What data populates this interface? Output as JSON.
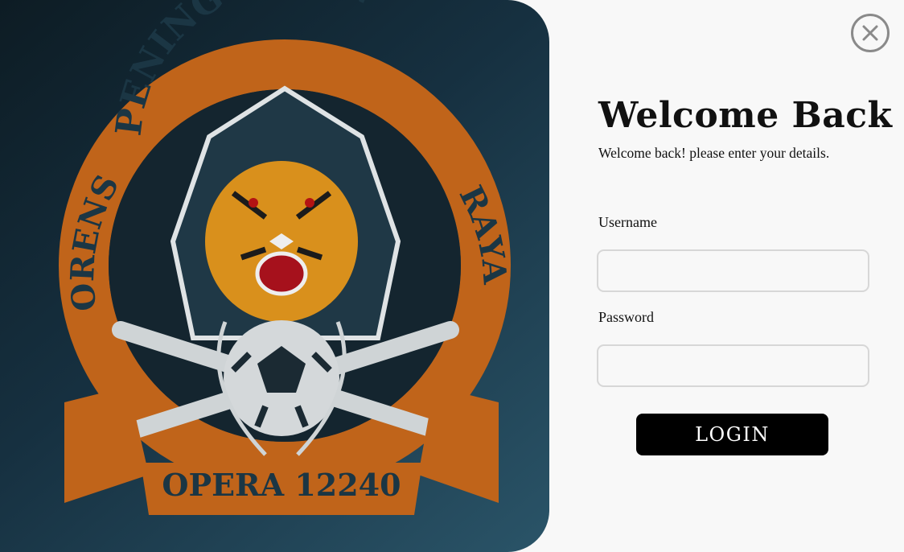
{
  "logo": {
    "name": "orens-peninggaran-raya-crest",
    "text_top": "PENINGGARAN",
    "text_left": "ORENS",
    "text_right": "RAYA",
    "text_banner": "OPERA 12240"
  },
  "colors": {
    "panel_dark": "#0d1c24",
    "panel_light": "#2a5468",
    "ring_orange": "#c0641a",
    "tiger_orange": "#d9901c",
    "button_black": "#000000",
    "input_border": "#d7d7d7",
    "close_gray": "#8a8a8a"
  },
  "dialog": {
    "close_icon": "close-icon",
    "title": "Welcome Back",
    "subtitle": "Welcome back! please enter your details."
  },
  "form": {
    "username_label": "Username",
    "username_value": "",
    "username_placeholder": "",
    "password_label": "Password",
    "password_value": "",
    "password_placeholder": "",
    "login_label": "LOGIN"
  }
}
